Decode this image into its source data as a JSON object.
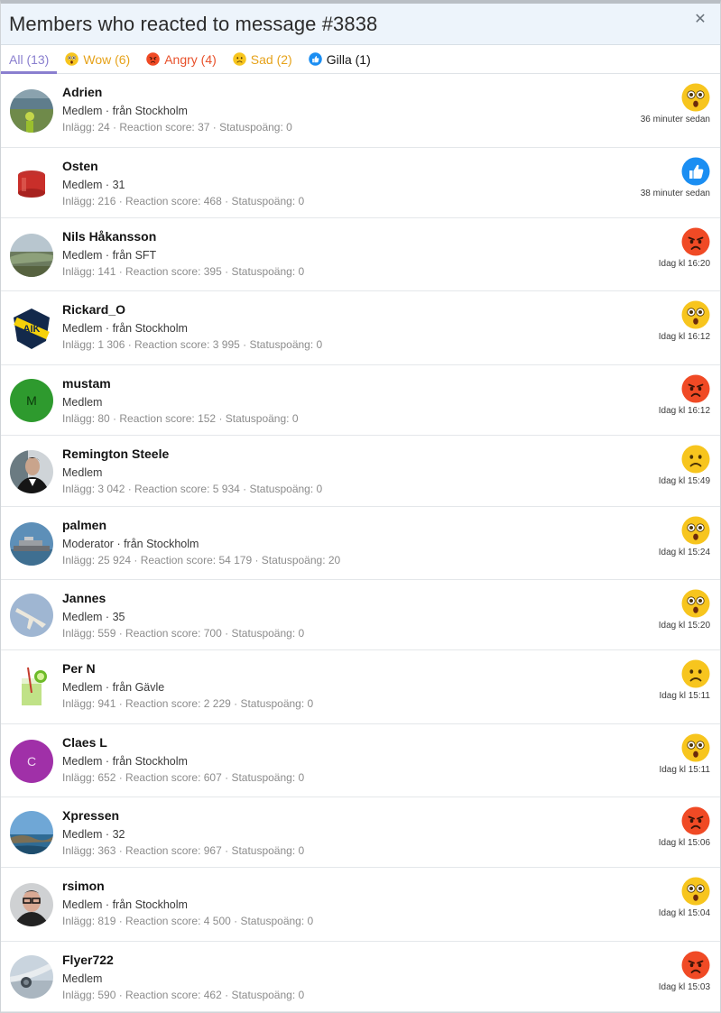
{
  "title": "Members who reacted to message #3838",
  "tabs": [
    {
      "label": "All (13)",
      "kind": "all"
    },
    {
      "label": "Wow (6)",
      "kind": "wow"
    },
    {
      "label": "Angry (4)",
      "kind": "angry"
    },
    {
      "label": "Sad (2)",
      "kind": "sad"
    },
    {
      "label": "Gilla (1)",
      "kind": "like"
    }
  ],
  "members": [
    {
      "name": "Adrien",
      "title": "Medlem · från Stockholm",
      "stats": "Inlägg: 24 · Reaction score: 37 · Statuspoäng: 0",
      "reaction": "wow",
      "time": "36 minuter sedan",
      "avatar": "photo-field"
    },
    {
      "name": "Osten",
      "title": "Medlem · 31",
      "stats": "Inlägg: 216 · Reaction score: 468 · Statuspoäng: 0",
      "reaction": "like",
      "time": "38 minuter sedan",
      "avatar": "photo-red-object"
    },
    {
      "name": "Nils Håkansson",
      "title": "Medlem · från SFT",
      "stats": "Inlägg: 141 · Reaction score: 395 · Statuspoäng: 0",
      "reaction": "angry",
      "time": "Idag kl 16:20",
      "avatar": "photo-landscape"
    },
    {
      "name": "Rickard_O",
      "title": "Medlem · från Stockholm",
      "stats": "Inlägg: 1 306 · Reaction score: 3 995 · Statuspoäng: 0",
      "reaction": "wow",
      "time": "Idag kl 16:12",
      "avatar": "badge-aik"
    },
    {
      "name": "mustam",
      "title": "Medlem",
      "stats": "Inlägg: 80 · Reaction score: 152 · Statuspoäng: 0",
      "reaction": "angry",
      "time": "Idag kl 16:12",
      "avatar": "letter-M"
    },
    {
      "name": "Remington Steele",
      "title": "Medlem",
      "stats": "Inlägg: 3 042 · Reaction score: 5 934 · Statuspoäng: 0",
      "reaction": "sad",
      "time": "Idag kl 15:49",
      "avatar": "photo-man-suit"
    },
    {
      "name": "palmen",
      "title": "Moderator · från Stockholm",
      "stats": "Inlägg: 25 924 · Reaction score: 54 179 · Statuspoäng: 20",
      "reaction": "wow",
      "time": "Idag kl 15:24",
      "avatar": "photo-ship"
    },
    {
      "name": "Jannes",
      "title": "Medlem · 35",
      "stats": "Inlägg: 559 · Reaction score: 700 · Statuspoäng: 0",
      "reaction": "wow",
      "time": "Idag kl 15:20",
      "avatar": "photo-jet"
    },
    {
      "name": "Per N",
      "title": "Medlem · från Gävle",
      "stats": "Inlägg: 941 · Reaction score: 2 229 · Statuspoäng: 0",
      "reaction": "sad",
      "time": "Idag kl 15:11",
      "avatar": "photo-drink"
    },
    {
      "name": "Claes L",
      "title": "Medlem · från Stockholm",
      "stats": "Inlägg: 652 · Reaction score: 607 · Statuspoäng: 0",
      "reaction": "wow",
      "time": "Idag kl 15:11",
      "avatar": "letter-C"
    },
    {
      "name": "Xpressen",
      "title": "Medlem · 32",
      "stats": "Inlägg: 363 · Reaction score: 967 · Statuspoäng: 0",
      "reaction": "angry",
      "time": "Idag kl 15:06",
      "avatar": "photo-coast"
    },
    {
      "name": "rsimon",
      "title": "Medlem · från Stockholm",
      "stats": "Inlägg: 819 · Reaction score: 4 500 · Statuspoäng: 0",
      "reaction": "wow",
      "time": "Idag kl 15:04",
      "avatar": "photo-man-glasses"
    },
    {
      "name": "Flyer722",
      "title": "Medlem",
      "stats": "Inlägg: 590 · Reaction score: 462 · Statuspoäng: 0",
      "reaction": "angry",
      "time": "Idag kl 15:03",
      "avatar": "photo-aircraft-window"
    }
  ],
  "colors": {
    "accent": "#8a7fcf",
    "wow": "#e6a21a",
    "angry": "#e8512b",
    "sad": "#e6a21a",
    "like": "#1b8ef2",
    "avatar_M": "#2e9a2e",
    "avatar_C": "#a030a8"
  }
}
